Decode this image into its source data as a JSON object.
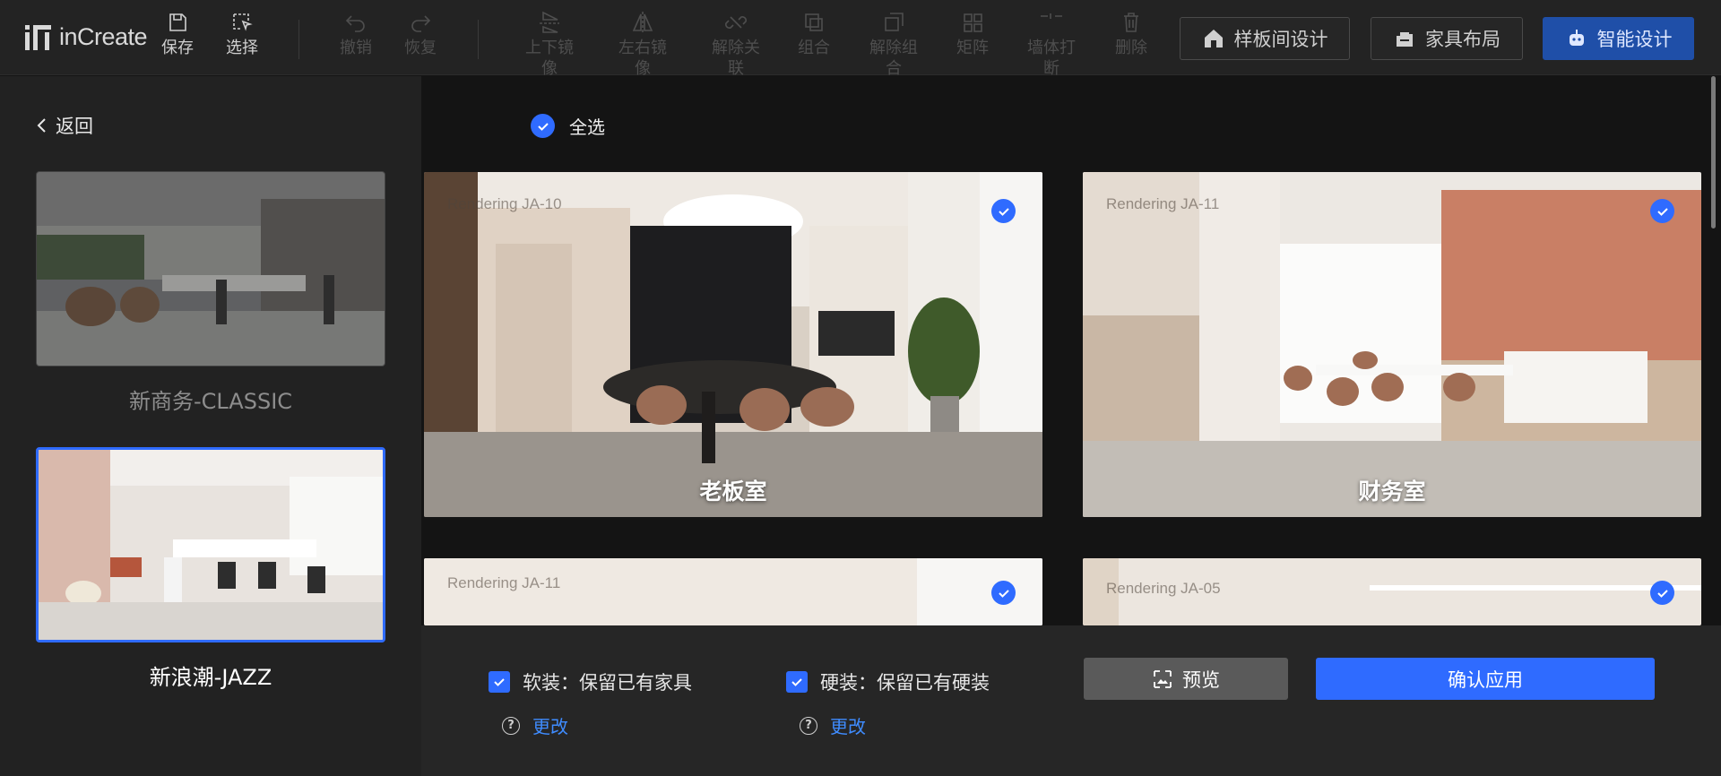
{
  "app": {
    "logo_text": "inCreate"
  },
  "toolbar": {
    "tools": [
      {
        "label": "保存",
        "icon": "save-icon",
        "enabled": true
      },
      {
        "label": "选择",
        "icon": "select-icon",
        "enabled": true
      },
      {
        "label": "撤销",
        "icon": "undo-icon",
        "enabled": false
      },
      {
        "label": "恢复",
        "icon": "redo-icon",
        "enabled": false
      },
      {
        "label": "上下镜像",
        "icon": "flip-vertical-icon",
        "enabled": false
      },
      {
        "label": "左右镜像",
        "icon": "flip-horizontal-icon",
        "enabled": false
      },
      {
        "label": "解除关联",
        "icon": "unlink-icon",
        "enabled": false
      },
      {
        "label": "组合",
        "icon": "group-icon",
        "enabled": false
      },
      {
        "label": "解除组合",
        "icon": "ungroup-icon",
        "enabled": false
      },
      {
        "label": "矩阵",
        "icon": "matrix-icon",
        "enabled": false
      },
      {
        "label": "墙体打断",
        "icon": "wall-break-icon",
        "enabled": false
      },
      {
        "label": "删除",
        "icon": "trash-icon",
        "enabled": false
      }
    ],
    "buttons": {
      "sample_room": "样板间设计",
      "furniture_layout": "家具布局",
      "smart_design": "智能设计"
    }
  },
  "sidebar": {
    "back_label": "返回",
    "styles": [
      {
        "name": "新商务-CLASSIC",
        "selected": false
      },
      {
        "name": "新浪潮-JAZZ",
        "selected": true
      }
    ]
  },
  "main": {
    "select_all_label": "全选",
    "rooms": [
      {
        "tag": "Rendering   JA-10",
        "name": "老板室",
        "checked": true
      },
      {
        "tag": "Rendering   JA-11",
        "name": "财务室",
        "checked": true
      },
      {
        "tag": "Rendering   JA-11",
        "name": "",
        "checked": true
      },
      {
        "tag": "Rendering   JA-05",
        "name": "",
        "checked": true
      }
    ]
  },
  "bottom": {
    "soft_option": "软装：保留已有家具",
    "hard_option": "硬装：保留已有硬装",
    "soft_checked": true,
    "hard_checked": true,
    "change_label": "更改",
    "preview_label": "预览",
    "apply_label": "确认应用"
  },
  "colors": {
    "accent": "#2f6bff",
    "link": "#3f8cff",
    "smart_button": "#1f4fa8"
  }
}
